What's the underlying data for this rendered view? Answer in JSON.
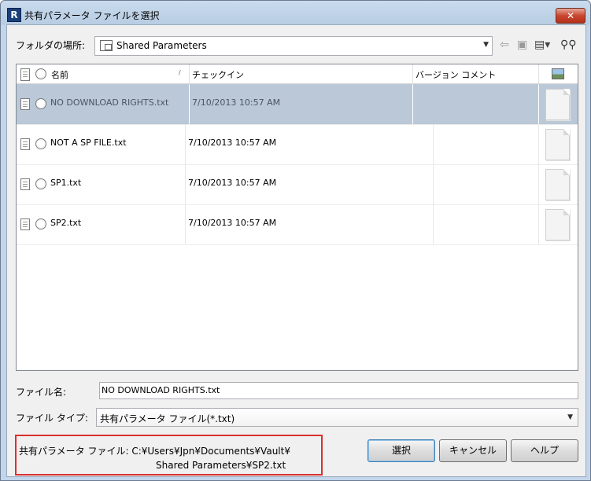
{
  "window": {
    "title": "共有パラメータ ファイルを選択",
    "close_symbol": "✕"
  },
  "location": {
    "label": "フォルダの場所:",
    "value": "Shared Parameters"
  },
  "toolbar": {
    "icons": [
      "back-arrow-icon",
      "up-folder-icon",
      "views-icon",
      "search-binoculars-icon"
    ]
  },
  "file_list": {
    "columns": {
      "name": "名前",
      "checkin": "チェックイン",
      "version_comment": "バージョン コメント"
    },
    "rows": [
      {
        "name": "NO DOWNLOAD RIGHTS.txt",
        "checkin": "7/10/2013 10:57 AM",
        "selected": true
      },
      {
        "name": "NOT A SP FILE.txt",
        "checkin": "7/10/2013 10:57 AM",
        "selected": false
      },
      {
        "name": "SP1.txt",
        "checkin": "7/10/2013 10:57 AM",
        "selected": false
      },
      {
        "name": "SP2.txt",
        "checkin": "7/10/2013 10:57 AM",
        "selected": false
      }
    ]
  },
  "filename": {
    "label": "ファイル名:",
    "value": "NO DOWNLOAD RIGHTS.txt"
  },
  "filetype": {
    "label": "ファイル タイプ:",
    "value": "共有パラメータ ファイル(*.txt)"
  },
  "shared_param_file": {
    "line1": "共有パラメータ ファイル: C:¥Users¥Jpn¥Documents¥Vault¥",
    "line2": "Shared Parameters¥SP2.txt"
  },
  "buttons": {
    "select": "選択",
    "cancel": "キャンセル",
    "help": "ヘルプ"
  },
  "colors": {
    "selection": "#bac8d7",
    "highlight_box": "#d9302e"
  }
}
